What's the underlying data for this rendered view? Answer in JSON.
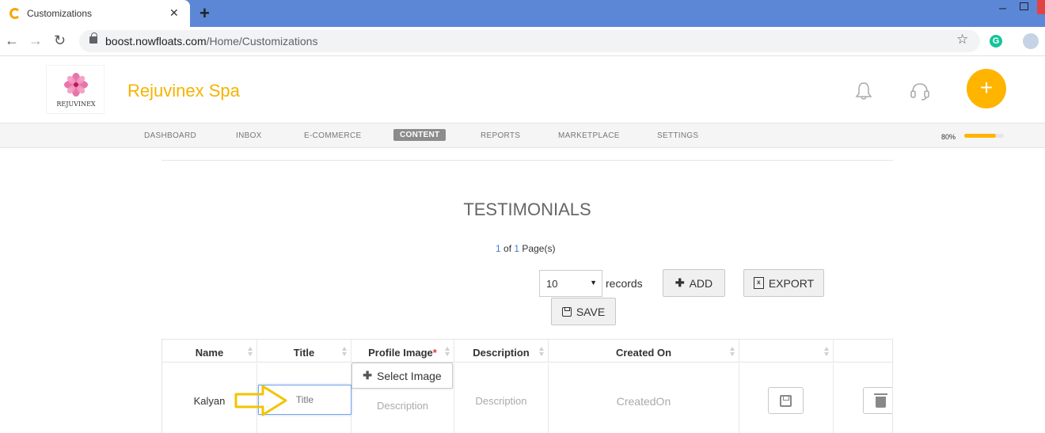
{
  "browser": {
    "tab_title": "Customizations",
    "tab_close": "✕",
    "new_tab": "+",
    "url_host": "boost.nowfloats.com",
    "url_path": "/Home/Customizations"
  },
  "header": {
    "logo_text": "REJUVINEX",
    "brand_name": "Rejuvinex Spa",
    "fab_label": "+"
  },
  "nav": {
    "items": [
      "DASHBOARD",
      "INBOX",
      "E-COMMERCE",
      "CONTENT",
      "REPORTS",
      "MARKETPLACE",
      "SETTINGS"
    ],
    "active": "CONTENT",
    "progress_label": "80%",
    "progress_value": 0.8
  },
  "main": {
    "title": "TESTIMONIALS",
    "pager": {
      "current": "1",
      "of_text": "of",
      "total": "1",
      "suffix": "Page(s)"
    },
    "records_select": "10",
    "records_label": "records",
    "add_label": "ADD",
    "export_label": "EXPORT",
    "save_label": "SAVE"
  },
  "table": {
    "columns": [
      "Name",
      "Title",
      "Profile Image",
      "Description",
      "Created On",
      "",
      ""
    ],
    "required_mark": "*",
    "row": {
      "name": "Kalyan",
      "title_placeholder": "Title",
      "select_image_label": "Select Image",
      "profile_description_placeholder": "Description",
      "description_placeholder": "Description",
      "created_on_placeholder": "CreatedOn"
    }
  },
  "colors": {
    "brand": "#f5b301",
    "tabbar": "#5b87d6",
    "highlight_arrow": "#f2c400"
  }
}
